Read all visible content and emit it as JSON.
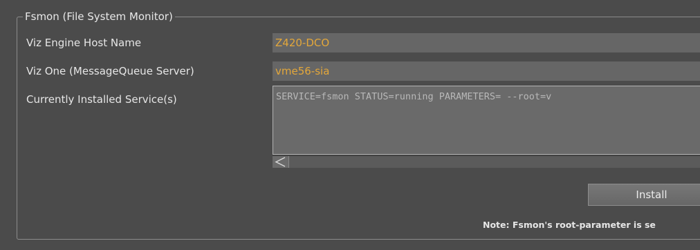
{
  "group": {
    "title": "Fsmon (File System Monitor)"
  },
  "fields": {
    "host_label": "Viz Engine Host Name",
    "host_value": "Z420-DCO",
    "mq_label": "Viz One (MessageQueue Server)",
    "mq_value": "vme56-sia",
    "services_label": "Currently Installed Service(s)",
    "services_value": "SERVICE=fsmon STATUS=running PARAMETERS= --root=v"
  },
  "buttons": {
    "install_label": "Install"
  },
  "note": "Note: Fsmon's root-parameter is se",
  "colors": {
    "background": "#4b4b4b",
    "value_text": "#e3a73a",
    "field_bg": "#666666"
  }
}
